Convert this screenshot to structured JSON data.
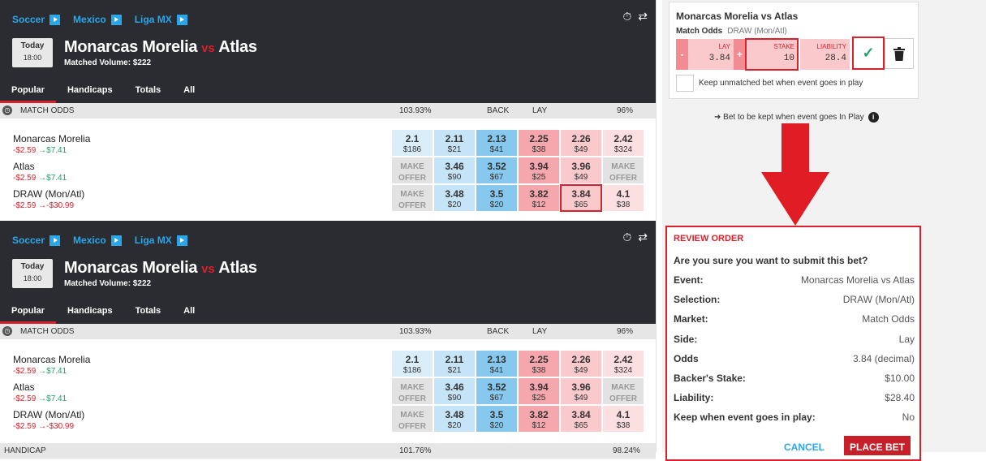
{
  "events": [
    {
      "breadcrumbs": [
        "Soccer",
        "Mexico",
        "Liga MX"
      ],
      "date": {
        "day": "Today",
        "time": "18:00"
      },
      "title": {
        "home": "Monarcas Morelia",
        "vs": "vs",
        "away": "Atlas"
      },
      "volume": "Matched Volume: $222",
      "tabs": [
        "Popular",
        "Handicaps",
        "Totals",
        "All"
      ],
      "market": {
        "name": "MATCH ODDS",
        "back_pct": "103.93%",
        "back": "BACK",
        "lay": "LAY",
        "lay_pct": "96%"
      },
      "runners": [
        {
          "name": "Monarcas Morelia",
          "pl_neg": "-$2.59",
          "pl_arrow": "→",
          "pl_pos": "$7.41",
          "odds": [
            [
              "2.1",
              "$186"
            ],
            [
              "2.11",
              "$21"
            ],
            [
              "2.13",
              "$41"
            ],
            [
              "2.25",
              "$38"
            ],
            [
              "2.26",
              "$49"
            ],
            [
              "2.42",
              "$324"
            ]
          ]
        },
        {
          "name": "Atlas",
          "pl_neg": "-$2.59",
          "pl_arrow": "→",
          "pl_pos": "$7.41",
          "odds": [
            [
              "MAKE",
              "OFFER"
            ],
            [
              "3.46",
              "$90"
            ],
            [
              "3.52",
              "$67"
            ],
            [
              "3.94",
              "$25"
            ],
            [
              "3.96",
              "$49"
            ],
            [
              "MAKE",
              "OFFER"
            ]
          ]
        },
        {
          "name": "DRAW (Mon/Atl)",
          "pl_neg": "-$2.59",
          "pl_arrow": "→",
          "pl_pos": "-$30.99",
          "odds": [
            [
              "MAKE",
              "OFFER"
            ],
            [
              "3.48",
              "$20"
            ],
            [
              "3.5",
              "$20"
            ],
            [
              "3.82",
              "$12"
            ],
            [
              "3.84",
              "$65"
            ],
            [
              "4.1",
              "$38"
            ]
          ]
        }
      ]
    },
    {
      "breadcrumbs": [
        "Soccer",
        "Mexico",
        "Liga MX"
      ],
      "date": {
        "day": "Today",
        "time": "18:00"
      },
      "title": {
        "home": "Monarcas Morelia",
        "vs": "vs",
        "away": "Atlas"
      },
      "volume": "Matched Volume: $222",
      "tabs": [
        "Popular",
        "Handicaps",
        "Totals",
        "All"
      ],
      "market": {
        "name": "MATCH ODDS",
        "back_pct": "103.93%",
        "back": "BACK",
        "lay": "LAY",
        "lay_pct": "96%"
      },
      "runners": [
        {
          "name": "Monarcas Morelia",
          "pl_neg": "-$2.59",
          "pl_arrow": "→",
          "pl_pos": "$7.41",
          "odds": [
            [
              "2.1",
              "$186"
            ],
            [
              "2.11",
              "$21"
            ],
            [
              "2.13",
              "$41"
            ],
            [
              "2.25",
              "$38"
            ],
            [
              "2.26",
              "$49"
            ],
            [
              "2.42",
              "$324"
            ]
          ]
        },
        {
          "name": "Atlas",
          "pl_neg": "-$2.59",
          "pl_arrow": "→",
          "pl_pos": "$7.41",
          "odds": [
            [
              "MAKE",
              "OFFER"
            ],
            [
              "3.46",
              "$90"
            ],
            [
              "3.52",
              "$67"
            ],
            [
              "3.94",
              "$25"
            ],
            [
              "3.96",
              "$49"
            ],
            [
              "MAKE",
              "OFFER"
            ]
          ]
        },
        {
          "name": "DRAW (Mon/Atl)",
          "pl_neg": "-$2.59",
          "pl_arrow": "→",
          "pl_pos": "-$30.99",
          "odds": [
            [
              "MAKE",
              "OFFER"
            ],
            [
              "3.48",
              "$20"
            ],
            [
              "3.5",
              "$20"
            ],
            [
              "3.82",
              "$12"
            ],
            [
              "3.84",
              "$65"
            ],
            [
              "4.1",
              "$38"
            ]
          ]
        }
      ],
      "next_market": {
        "name": "HANDICAP",
        "back_pct": "101.76%",
        "lay_pct": "98.24%"
      }
    }
  ],
  "betslip": {
    "event": "Monarcas Morelia vs Atlas",
    "market": "Match Odds",
    "selection": "DRAW (Mon/Atl)",
    "lay_label": "LAY",
    "lay_value": "3.84",
    "stake_label": "STAKE",
    "stake_value": "10",
    "liability_label": "LIABILITY",
    "liability_value": "28.4",
    "minus": "-",
    "plus": "+",
    "keep_label": "Keep unmatched bet when event goes in play",
    "note": "➜ Bet to be kept when event goes In Play"
  },
  "review": {
    "title": "REVIEW ORDER",
    "question": "Are you sure you want to submit this bet?",
    "rows": [
      {
        "k": "Event:",
        "v": "Monarcas Morelia vs Atlas"
      },
      {
        "k": "Selection:",
        "v": "DRAW (Mon/Atl)"
      },
      {
        "k": "Market:",
        "v": "Match Odds"
      },
      {
        "k": "Side:",
        "v": "Lay"
      },
      {
        "k": "Odds",
        "v": "3.84 (decimal)"
      },
      {
        "k": "Backer's Stake:",
        "v": "$10.00"
      },
      {
        "k": "Liability:",
        "v": "$28.40"
      },
      {
        "k": "Keep when event goes in play:",
        "v": "No"
      }
    ],
    "cancel": "CANCEL",
    "place": "PLACE BET"
  },
  "colors": {
    "accent_red": "#d9212b",
    "link_blue": "#2aa7e8",
    "profit_green": "#21a066",
    "header_bg": "#2a2c31"
  }
}
